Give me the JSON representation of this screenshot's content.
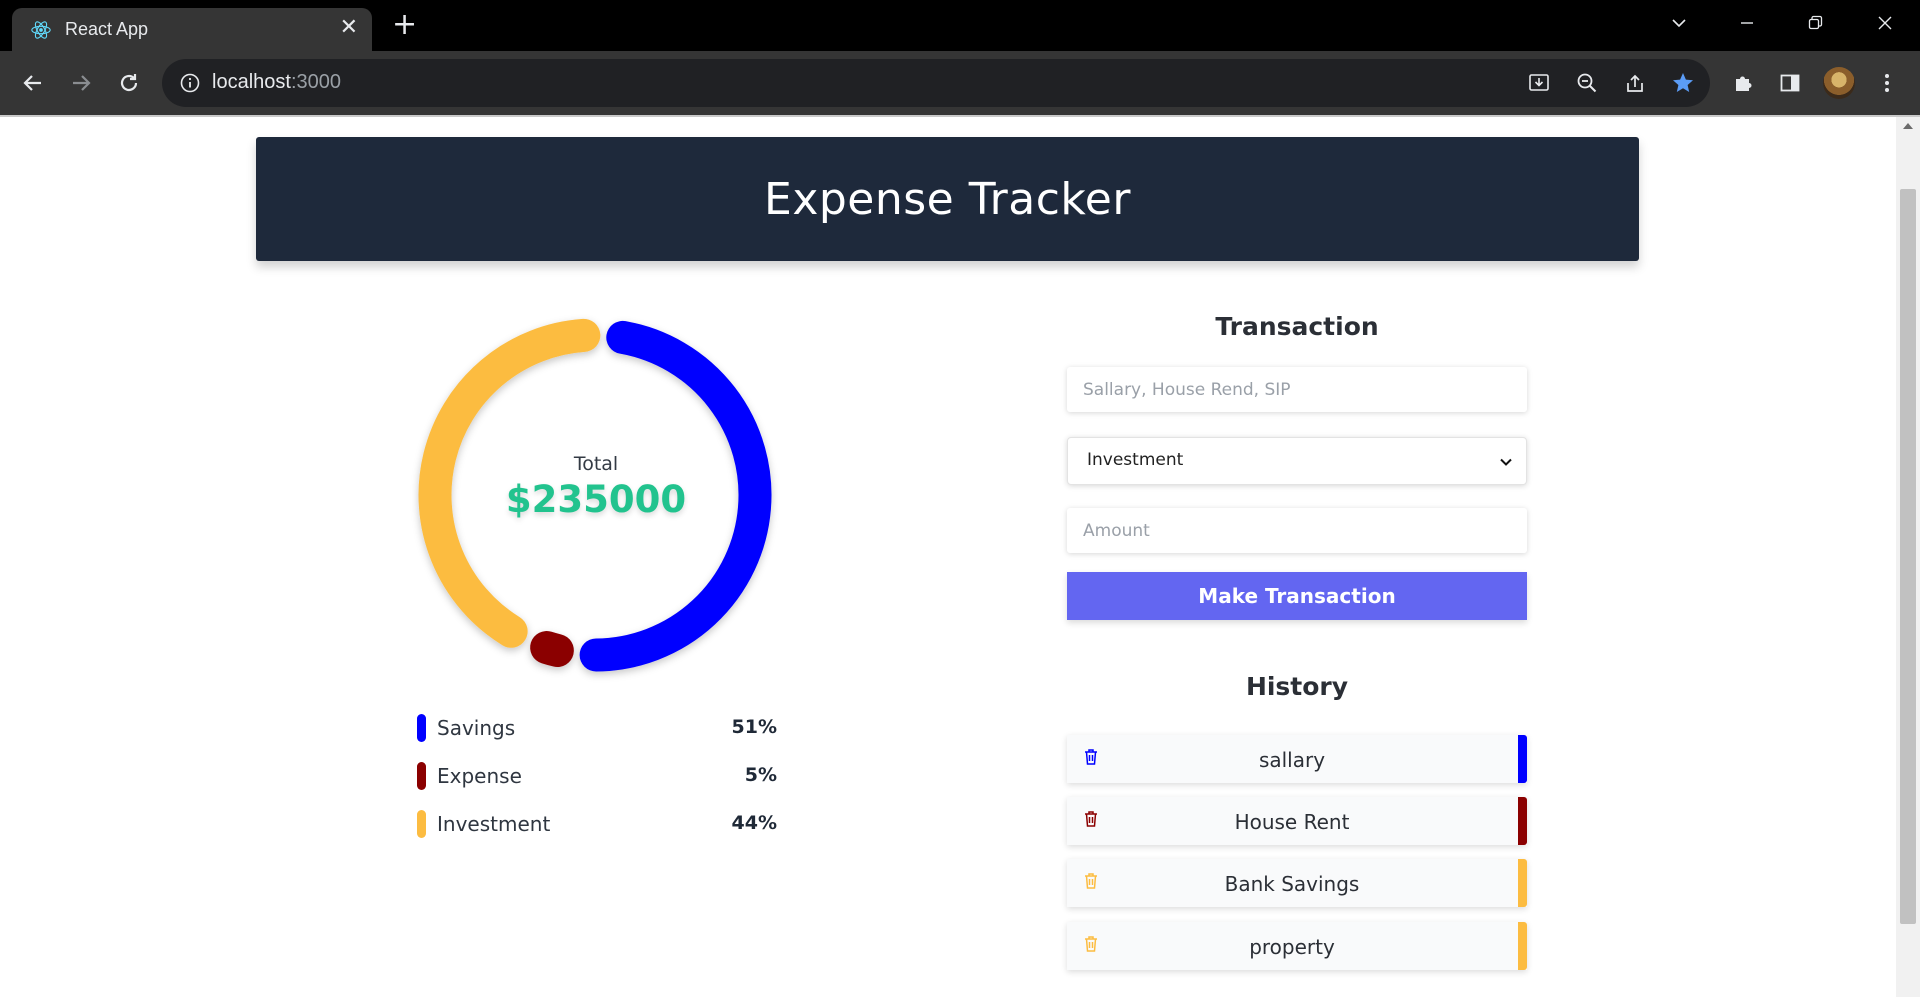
{
  "browser": {
    "tab_title": "React App",
    "tab_close": "✕",
    "new_tab": "+",
    "url_host": "localhost",
    "url_port": ":3000"
  },
  "app": {
    "title": "Expense Tracker",
    "total_label": "Total",
    "total_value": "$235000"
  },
  "colors": {
    "savings": "#0000ff",
    "expense": "#8b0000",
    "investment": "#fcbc41",
    "button": "#6366f1",
    "header": "#1e293b",
    "total": "#22c38e"
  },
  "chart_data": {
    "type": "pie",
    "categories": [
      "Savings",
      "Expense",
      "Investment"
    ],
    "values": [
      51,
      5,
      44
    ],
    "unit": "%"
  },
  "legend": [
    {
      "label": "Savings",
      "percent": "51%",
      "color": "#0000ff"
    },
    {
      "label": "Expense",
      "percent": "5%",
      "color": "#8b0000"
    },
    {
      "label": "Investment",
      "percent": "44%",
      "color": "#fcbc41"
    }
  ],
  "transaction": {
    "title": "Transaction",
    "name_placeholder": "Sallary, House Rend, SIP",
    "type_selected": "Investment",
    "amount_placeholder": "Amount",
    "submit_label": "Make Transaction"
  },
  "history": {
    "title": "History",
    "items": [
      {
        "name": "sallary",
        "color": "#0000ff"
      },
      {
        "name": "House Rent",
        "color": "#8b0000"
      },
      {
        "name": "Bank Savings",
        "color": "#fcbc41"
      },
      {
        "name": "property",
        "color": "#fcbc41"
      }
    ]
  }
}
